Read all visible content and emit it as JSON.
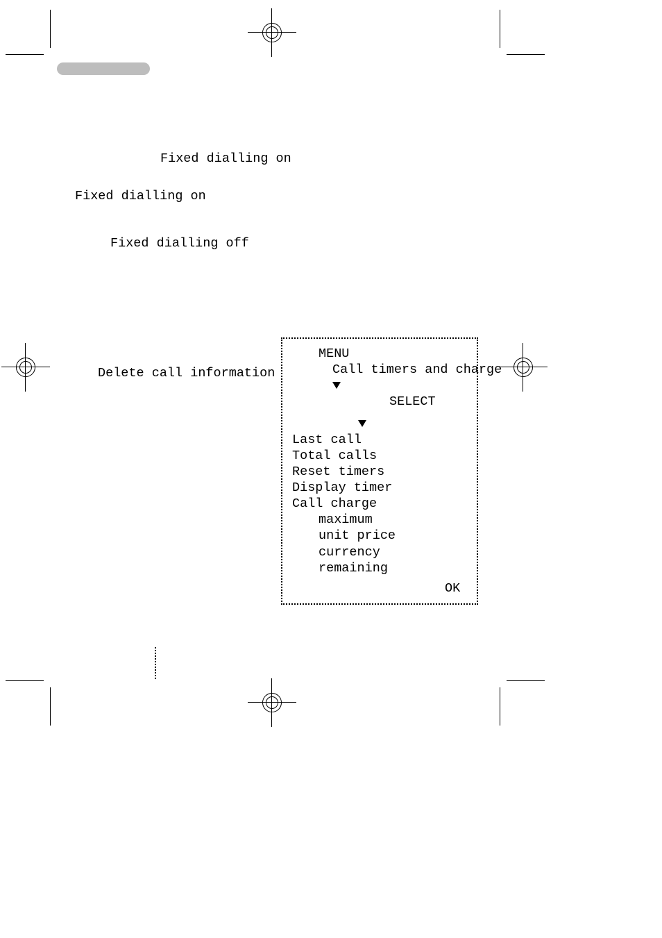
{
  "label_fixed_on_1": "Fixed dialling on",
  "label_fixed_on_2": "Fixed dialling on",
  "label_fixed_off": "Fixed dialling off",
  "label_delete_call_info": "Delete call information",
  "menu": {
    "header": "MENU",
    "title": "Call timers and charge",
    "select": "SELECT",
    "items": {
      "last": "Last call",
      "total": "Total calls",
      "reset": "Reset timers",
      "display": "Display timer",
      "charge": "Call charge",
      "charge_max": "maximum",
      "charge_unit": "unit price",
      "charge_curr": "currency",
      "charge_rem": "remaining"
    },
    "ok": "OK"
  }
}
